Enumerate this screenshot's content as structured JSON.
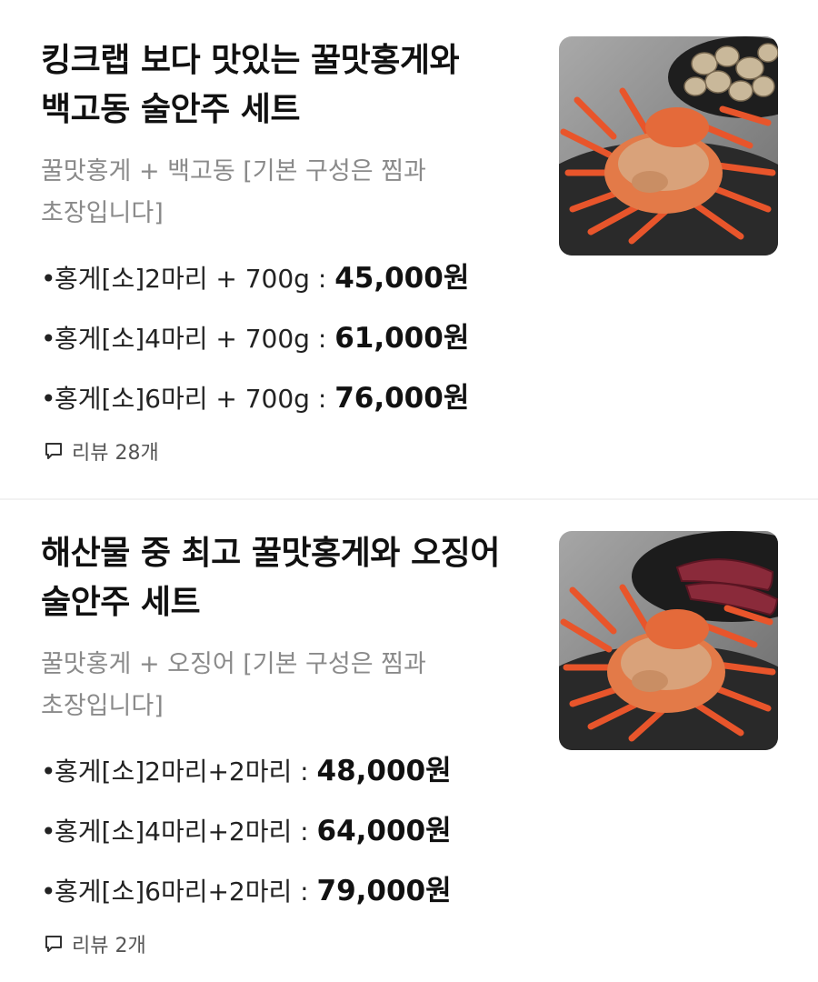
{
  "items": [
    {
      "title_line1": "킹크랩 보다 맛있는 꿀맛홍게와",
      "title_line2": "백고동 술안주 세트",
      "desc_line1": "꿀맛홍게 + 백고동 [기본 구성은 찜과",
      "desc_line2": "초장입니다]",
      "options": [
        {
          "label": "홍게[소]2마리 + 700g : ",
          "price": "45,000원"
        },
        {
          "label": "홍게[소]4마리 + 700g : ",
          "price": "61,000원"
        },
        {
          "label": "홍게[소]6마리 + 700g : ",
          "price": "76,000원"
        }
      ],
      "review_text": "리뷰 28개"
    },
    {
      "title_line1": "해산물 중 최고 꿀맛홍게와 오징어",
      "title_line2": "술안주 세트",
      "desc_line1": "꿀맛홍게 + 오징어 [기본 구성은 찜과",
      "desc_line2": "초장입니다]",
      "options": [
        {
          "label": "홍게[소]2마리+2마리 : ",
          "price": "48,000원"
        },
        {
          "label": "홍게[소]4마리+2마리 : ",
          "price": "64,000원"
        },
        {
          "label": "홍게[소]6마리+2마리 : ",
          "price": "79,000원"
        }
      ],
      "review_text": "리뷰 2개"
    }
  ],
  "icons": {
    "review": "speech-bubble-icon"
  },
  "colors": {
    "title": "#111111",
    "desc": "#8a8a8a",
    "crab": "#e8552b",
    "plate": "#2b2b2b"
  }
}
